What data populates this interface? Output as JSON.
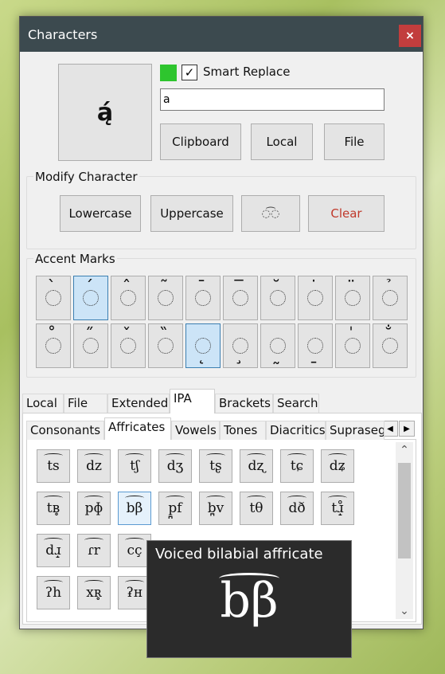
{
  "window": {
    "title": "Characters",
    "close_label": "×"
  },
  "preview": {
    "char": "ą́"
  },
  "smart_replace": {
    "label": "Smart Replace",
    "checked": true,
    "check_mark": "✓",
    "swatch_color": "#2ec52e"
  },
  "input": {
    "value": "a"
  },
  "output_buttons": [
    "Clipboard",
    "Local",
    "File"
  ],
  "modify": {
    "label": "Modify Character",
    "buttons": [
      "Lowercase",
      "Uppercase",
      "◌͡◌",
      "Clear"
    ]
  },
  "accents": {
    "label": "Accent Marks",
    "row1": [
      {
        "mark": "̀",
        "pos": "top",
        "selected": false
      },
      {
        "mark": "́",
        "pos": "top",
        "selected": true
      },
      {
        "mark": "̂",
        "pos": "top",
        "selected": false
      },
      {
        "mark": "̃",
        "pos": "top",
        "selected": false
      },
      {
        "mark": "̄",
        "pos": "top",
        "selected": false
      },
      {
        "mark": "̅",
        "pos": "top",
        "selected": false
      },
      {
        "mark": "̆",
        "pos": "top",
        "selected": false
      },
      {
        "mark": "̇",
        "pos": "top",
        "selected": false
      },
      {
        "mark": "̈",
        "pos": "top",
        "selected": false
      },
      {
        "mark": "̉",
        "pos": "top",
        "selected": false
      }
    ],
    "row2": [
      {
        "mark": "̊",
        "pos": "top",
        "selected": false
      },
      {
        "mark": "̋",
        "pos": "top",
        "selected": false
      },
      {
        "mark": "̌",
        "pos": "top",
        "selected": false
      },
      {
        "mark": "̏",
        "pos": "top",
        "selected": false
      },
      {
        "mark": "̨",
        "pos": "bot",
        "selected": true
      },
      {
        "mark": "̧",
        "pos": "bot",
        "selected": false
      },
      {
        "mark": "̰",
        "pos": "bot",
        "selected": false
      },
      {
        "mark": "̱",
        "pos": "bot",
        "selected": false
      },
      {
        "mark": "̍",
        "pos": "top",
        "selected": false
      },
      {
        "mark": "̐",
        "pos": "top",
        "selected": false
      }
    ]
  },
  "main_tabs": [
    "Local",
    "File",
    "Extended",
    "IPA",
    "Brackets",
    "Search"
  ],
  "main_tab_active": "IPA",
  "sub_tabs": [
    "Consonants",
    "Affricates",
    "Vowels",
    "Tones",
    "Diacritics",
    "Suprasegi"
  ],
  "sub_tab_active": "Affricates",
  "scroll_arrows": {
    "left": "◀",
    "right": "▶",
    "up": "⌃",
    "down": "⌄"
  },
  "affricates": [
    [
      "ts",
      "dz",
      "tʃ",
      "dʒ",
      "tʂ",
      "dʐ",
      "tɕ",
      "dʑ"
    ],
    [
      "tʙ̥",
      "pɸ",
      "bβ",
      "p̪f",
      "b̪v",
      "tθ",
      "dð",
      "tɹ̝̊"
    ],
    [
      "dɹ̝",
      "ɾr",
      "cç",
      "",
      "",
      "",
      "",
      ""
    ],
    [
      "ʔh",
      "xʀ̥",
      "ʡʜ",
      "",
      "",
      "",
      "",
      ""
    ]
  ],
  "selected_affricate": "bβ",
  "tooltip": {
    "title": "Voiced bilabial affricate",
    "char": "bβ"
  }
}
